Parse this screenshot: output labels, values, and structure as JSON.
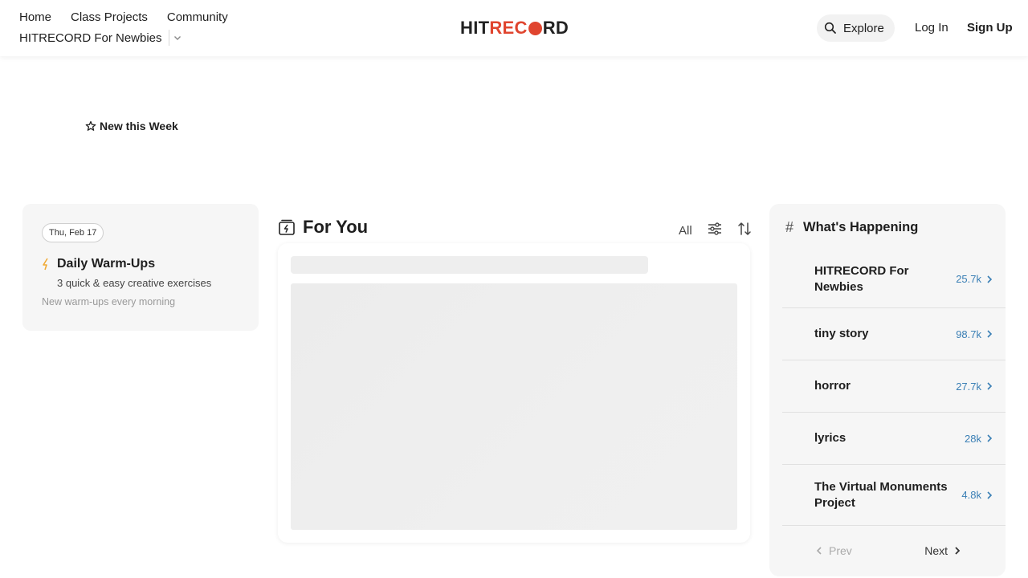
{
  "header": {
    "nav": [
      "Home",
      "Class Projects",
      "Community"
    ],
    "community_selected": "HITRECORD For Newbies",
    "logo": {
      "part1": "HIT",
      "part2": "REC",
      "part3": "RD"
    },
    "explore_label": "Explore",
    "login_label": "Log In",
    "signup_label": "Sign Up"
  },
  "new_this_week": {
    "label": "New this Week",
    "icon": "star-outline-icon"
  },
  "warmup": {
    "date": "Thu, Feb 17",
    "title": "Daily Warm-Ups",
    "subtitle": "3 quick & easy creative exercises",
    "note": "New warm-ups every morning",
    "icon": "lightning-icon",
    "accent": "#f0a830"
  },
  "for_you": {
    "title": "For You",
    "filter_label": "All",
    "icons": [
      "for-you-icon",
      "filter-sliders-icon",
      "sort-icon"
    ]
  },
  "happening": {
    "title": "What's Happening",
    "topics": [
      {
        "name": "HITRECORD For Newbies",
        "count": "25.7k"
      },
      {
        "name": "tiny story",
        "count": "98.7k"
      },
      {
        "name": "horror",
        "count": "27.7k"
      },
      {
        "name": "lyrics",
        "count": "28k"
      },
      {
        "name": "The Virtual Monuments Project",
        "count": "4.8k"
      }
    ],
    "prev_label": "Prev",
    "next_label": "Next",
    "count_color": "#3a7fb5"
  },
  "colors": {
    "brand_red": "#e0452f",
    "card_bg": "#f6f6f6"
  }
}
